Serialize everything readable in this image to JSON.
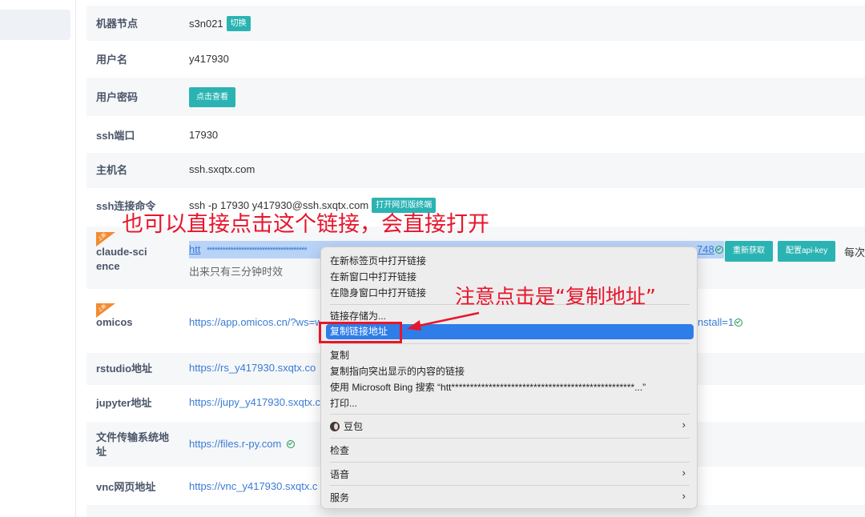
{
  "rows": [
    {
      "label": "机器节点",
      "value": "s3n021",
      "button": "切换"
    },
    {
      "label": "用户名",
      "value": "y417930"
    },
    {
      "label": "用户密码",
      "button": "点击查看"
    },
    {
      "label": "ssh端口",
      "value": "17930"
    },
    {
      "label": "主机名",
      "value": "ssh.sxqtx.com"
    },
    {
      "label": "ssh连接命令",
      "value": "ssh -p 17930 y417930@ssh.sxqtx.com",
      "button": "打开网页版终端"
    }
  ],
  "claude": {
    "badge": "上新",
    "label_line1": "claude-sci",
    "label_line2": "ence",
    "url_start": "htt",
    "url_end": "748",
    "note": "出来只有三分钟时效",
    "btn_refresh": "重新获取",
    "btn_apikey": "配置api-key",
    "trailing": "每次"
  },
  "omicos": {
    "badge": "上新",
    "label": "omicos",
    "url": "https://app.omicos.cn/?ws=w",
    "url_tail": "nstall=1"
  },
  "links": [
    {
      "label": "rstudio地址",
      "url": "https://rs_y417930.sxqtx.co"
    },
    {
      "label": "jupyter地址",
      "url": "https://jupy_y417930.sxqtx.c"
    },
    {
      "label_line1": "文件传输系统地",
      "label_line2": "址",
      "url": "https://files.r-py.com"
    },
    {
      "label": "vnc网页地址",
      "url": "https://vnc_y417930.sxqtx.c"
    }
  ],
  "annotations": {
    "top": "也可以直接点击这个链接，会直接打开",
    "menu": "注意点击是“复制地址”"
  },
  "menu": {
    "items": [
      "在新标签页中打开链接",
      "在新窗口中打开链接",
      "在隐身窗口中打开链接",
      "链接存储为...",
      "复制链接地址",
      "复制",
      "复制指向突出显示的内容的链接",
      "使用 Microsoft Bing 搜索 “htt*************************************************...”",
      "打印...",
      "豆包",
      "检查",
      "语音",
      "服务"
    ],
    "selected": "复制链接地址"
  },
  "colors": {
    "accent": "#2bb3b3",
    "link": "#3a7bd5",
    "annotation": "#e8152b",
    "menu_selected": "#2f7de8",
    "badge": "#f28a30"
  }
}
